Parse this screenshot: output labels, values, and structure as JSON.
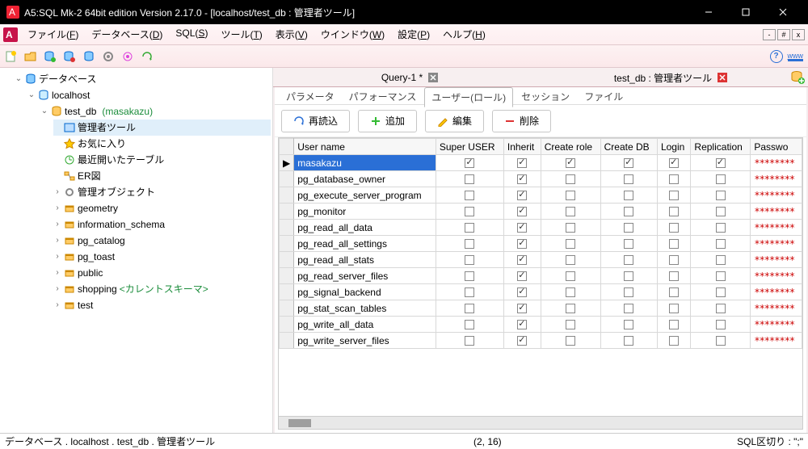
{
  "title": "A5:SQL Mk-2 64bit edition Version 2.17.0 - [localhost/test_db : 管理者ツール]",
  "menus": [
    "ファイル(F)",
    "データベース(D)",
    "SQL(S)",
    "ツール(T)",
    "表示(V)",
    "ウインドウ(W)",
    "設定(P)",
    "ヘルプ(H)"
  ],
  "tree": {
    "root": "データベース",
    "host": "localhost",
    "db": "test_db",
    "dbuser": "(masakazu)",
    "db_children": [
      {
        "icon": "admin",
        "label": "管理者ツール",
        "sel": true
      },
      {
        "icon": "star",
        "label": "お気に入り"
      },
      {
        "icon": "clock",
        "label": "最近開いたテーブル"
      },
      {
        "icon": "er",
        "label": "ER図"
      }
    ],
    "schemas": [
      {
        "label": "管理オブジェクト",
        "icon": "gear"
      },
      {
        "label": "geometry",
        "icon": "schema"
      },
      {
        "label": "information_schema",
        "icon": "schema"
      },
      {
        "label": "pg_catalog",
        "icon": "schema"
      },
      {
        "label": "pg_toast",
        "icon": "schema"
      },
      {
        "label": "public",
        "icon": "schema"
      },
      {
        "label": "shopping",
        "icon": "schema",
        "suffix": "<カレントスキーマ>"
      },
      {
        "label": "test",
        "icon": "schema"
      }
    ]
  },
  "fileTabs": [
    {
      "label": "Query-1 *",
      "close": "gray"
    },
    {
      "label": "test_db : 管理者ツール",
      "close": "red"
    }
  ],
  "innerTabs": [
    "パラメータ",
    "パフォーマンス",
    "ユーザー(ロール)",
    "セッション",
    "ファイル"
  ],
  "innerActive": 2,
  "actions": {
    "reload": "再読込",
    "add": "追加",
    "edit": "編集",
    "delete": "削除"
  },
  "grid": {
    "cols": [
      "User name",
      "Super USER",
      "Inherit",
      "Create role",
      "Create DB",
      "Login",
      "Replication",
      "Passwo"
    ],
    "rows": [
      {
        "name": "masakazu",
        "flags": [
          1,
          1,
          1,
          1,
          1,
          1
        ],
        "sel": true
      },
      {
        "name": "pg_database_owner",
        "flags": [
          0,
          1,
          0,
          0,
          0,
          0
        ]
      },
      {
        "name": "pg_execute_server_program",
        "flags": [
          0,
          1,
          0,
          0,
          0,
          0
        ]
      },
      {
        "name": "pg_monitor",
        "flags": [
          0,
          1,
          0,
          0,
          0,
          0
        ]
      },
      {
        "name": "pg_read_all_data",
        "flags": [
          0,
          1,
          0,
          0,
          0,
          0
        ]
      },
      {
        "name": "pg_read_all_settings",
        "flags": [
          0,
          1,
          0,
          0,
          0,
          0
        ]
      },
      {
        "name": "pg_read_all_stats",
        "flags": [
          0,
          1,
          0,
          0,
          0,
          0
        ]
      },
      {
        "name": "pg_read_server_files",
        "flags": [
          0,
          1,
          0,
          0,
          0,
          0
        ]
      },
      {
        "name": "pg_signal_backend",
        "flags": [
          0,
          1,
          0,
          0,
          0,
          0
        ]
      },
      {
        "name": "pg_stat_scan_tables",
        "flags": [
          0,
          1,
          0,
          0,
          0,
          0
        ]
      },
      {
        "name": "pg_write_all_data",
        "flags": [
          0,
          1,
          0,
          0,
          0,
          0
        ]
      },
      {
        "name": "pg_write_server_files",
        "flags": [
          0,
          1,
          0,
          0,
          0,
          0
        ]
      }
    ],
    "pwd_mask": "********"
  },
  "status": {
    "path": "データベース . localhost . test_db . 管理者ツール",
    "pos": "(2, 16)",
    "sep": "SQL区切り : \";\""
  }
}
